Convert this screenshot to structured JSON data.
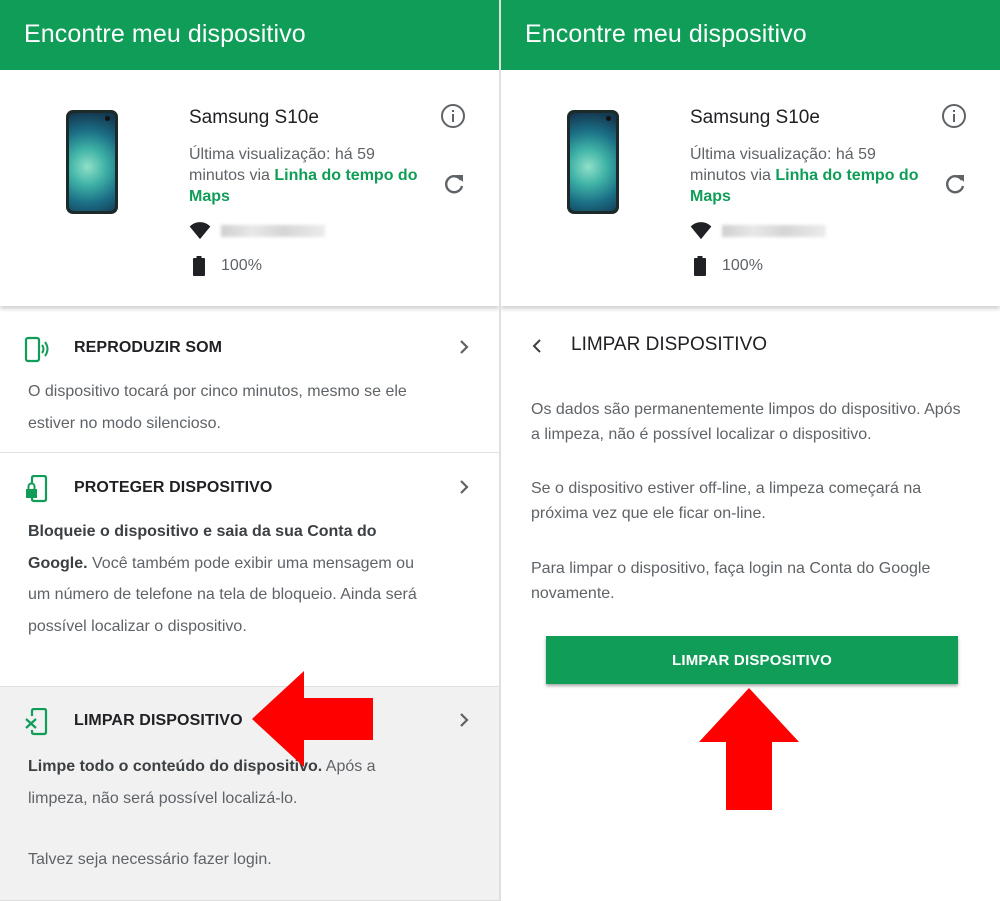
{
  "app": {
    "title": "Encontre meu dispositivo"
  },
  "device": {
    "name": "Samsung S10e",
    "last_seen_text": "Última visualização: há 59 minutos via ",
    "last_seen_link": "Linha do tempo do Maps",
    "battery": "100%",
    "icons": [
      "info-icon",
      "refresh-icon",
      "wifi-icon",
      "battery-icon"
    ]
  },
  "actions": {
    "play_sound": {
      "title": "REPRODUZIR SOM",
      "description": "O dispositivo tocará por cinco minutos, mesmo se ele estiver no modo silencioso."
    },
    "secure": {
      "title": "PROTEGER DISPOSITIVO",
      "description_bold": "Bloqueie o dispositivo e saia da sua Conta do Google.",
      "description": " Você também pode exibir uma mensagem ou um número de telefone na tela de bloqueio. Ainda será possível localizar o dispositivo."
    },
    "erase": {
      "title": "LIMPAR DISPOSITIVO",
      "description_bold": "Limpe todo o conteúdo do dispositivo.",
      "description": " Após a limpeza, não será possível localizá-lo.",
      "note": "Talvez seja necessário fazer login."
    }
  },
  "erase_panel": {
    "title": "LIMPAR DISPOSITIVO",
    "paragraph1": "Os dados são permanentemente limpos do dispositivo. Após a limpeza, não é possível localizar o dispositivo.",
    "paragraph2": "Se o dispositivo estiver off-line, a limpeza começará na próxima vez que ele ficar on-line.",
    "paragraph3": "Para limpar o dispositivo, faça login na Conta do Google novamente.",
    "button": "LIMPAR DISPOSITIVO"
  },
  "colors": {
    "brand_green": "#0f9d58",
    "annotation_red": "#ff0000"
  }
}
